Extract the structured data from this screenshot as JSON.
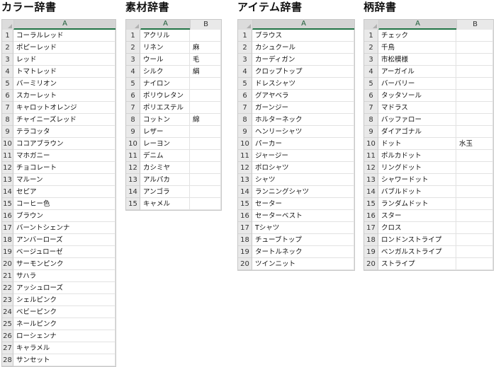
{
  "color": {
    "title": "カラー辞書",
    "columns": [
      "A"
    ],
    "rows": [
      [
        "コーラルレッド"
      ],
      [
        "ポピーレッド"
      ],
      [
        "レッド"
      ],
      [
        "トマトレッド"
      ],
      [
        "バーミリオン"
      ],
      [
        "スカーレット"
      ],
      [
        "キャロットオレンジ"
      ],
      [
        "チャイニーズレッド"
      ],
      [
        "テラコッタ"
      ],
      [
        "ココアブラウン"
      ],
      [
        "マホガニー"
      ],
      [
        "チョコレート"
      ],
      [
        "マルーン"
      ],
      [
        "セピア"
      ],
      [
        "コーヒー色"
      ],
      [
        "ブラウン"
      ],
      [
        "バーントシェンナ"
      ],
      [
        "アンバーローズ"
      ],
      [
        "ベージュローゼ"
      ],
      [
        "サーモンピンク"
      ],
      [
        "サハラ"
      ],
      [
        "アッシュローズ"
      ],
      [
        "シェルピンク"
      ],
      [
        "ベビーピンク"
      ],
      [
        "ネールピンク"
      ],
      [
        "ローシェンナ"
      ],
      [
        "キャラメル"
      ],
      [
        "サンセット"
      ]
    ]
  },
  "material": {
    "title": "素材辞書",
    "columns": [
      "A",
      "B"
    ],
    "rows": [
      [
        "アクリル",
        ""
      ],
      [
        "リネン",
        "麻"
      ],
      [
        "ウール",
        "毛"
      ],
      [
        "シルク",
        "絹"
      ],
      [
        "ナイロン",
        ""
      ],
      [
        "ポリウレタン",
        ""
      ],
      [
        "ポリエステル",
        ""
      ],
      [
        "コットン",
        "綿"
      ],
      [
        "レザー",
        ""
      ],
      [
        "レーヨン",
        ""
      ],
      [
        "デニム",
        ""
      ],
      [
        "カシミヤ",
        ""
      ],
      [
        "アルパカ",
        ""
      ],
      [
        "アンゴラ",
        ""
      ],
      [
        "キャメル",
        ""
      ]
    ]
  },
  "item": {
    "title": "アイテム辞書",
    "columns": [
      "A"
    ],
    "rows": [
      [
        "ブラウス"
      ],
      [
        "カシュクール"
      ],
      [
        "カーディガン"
      ],
      [
        "クロップトップ"
      ],
      [
        "ドレスシャツ"
      ],
      [
        "グアヤベラ"
      ],
      [
        "ガーンジー"
      ],
      [
        "ホルターネック"
      ],
      [
        "ヘンリーシャツ"
      ],
      [
        "パーカー"
      ],
      [
        "ジャージー"
      ],
      [
        "ポロシャツ"
      ],
      [
        "シャツ"
      ],
      [
        "ランニングシャツ"
      ],
      [
        "セーター"
      ],
      [
        "セーターベスト"
      ],
      [
        "Tシャツ"
      ],
      [
        "チューブトップ"
      ],
      [
        "タートルネック"
      ],
      [
        "ツインニット"
      ]
    ]
  },
  "pattern": {
    "title": "柄辞書",
    "columns": [
      "A",
      "B"
    ],
    "rows": [
      [
        "チェック",
        ""
      ],
      [
        "千鳥",
        ""
      ],
      [
        "市松模様",
        ""
      ],
      [
        "アーガイル",
        ""
      ],
      [
        "バーバリー",
        ""
      ],
      [
        "タッタソール",
        ""
      ],
      [
        "マドラス",
        ""
      ],
      [
        "バッファロー",
        ""
      ],
      [
        "ダイアゴナル",
        ""
      ],
      [
        "ドット",
        "水玉"
      ],
      [
        "ポルカドット",
        ""
      ],
      [
        "リングドット",
        ""
      ],
      [
        "シャワードット",
        ""
      ],
      [
        "バブルドット",
        ""
      ],
      [
        "ランダムドット",
        ""
      ],
      [
        "スター",
        ""
      ],
      [
        "クロス",
        ""
      ],
      [
        "ロンドンストライプ",
        ""
      ],
      [
        "ベンガルストライプ",
        ""
      ],
      [
        "ストライプ",
        ""
      ]
    ]
  }
}
